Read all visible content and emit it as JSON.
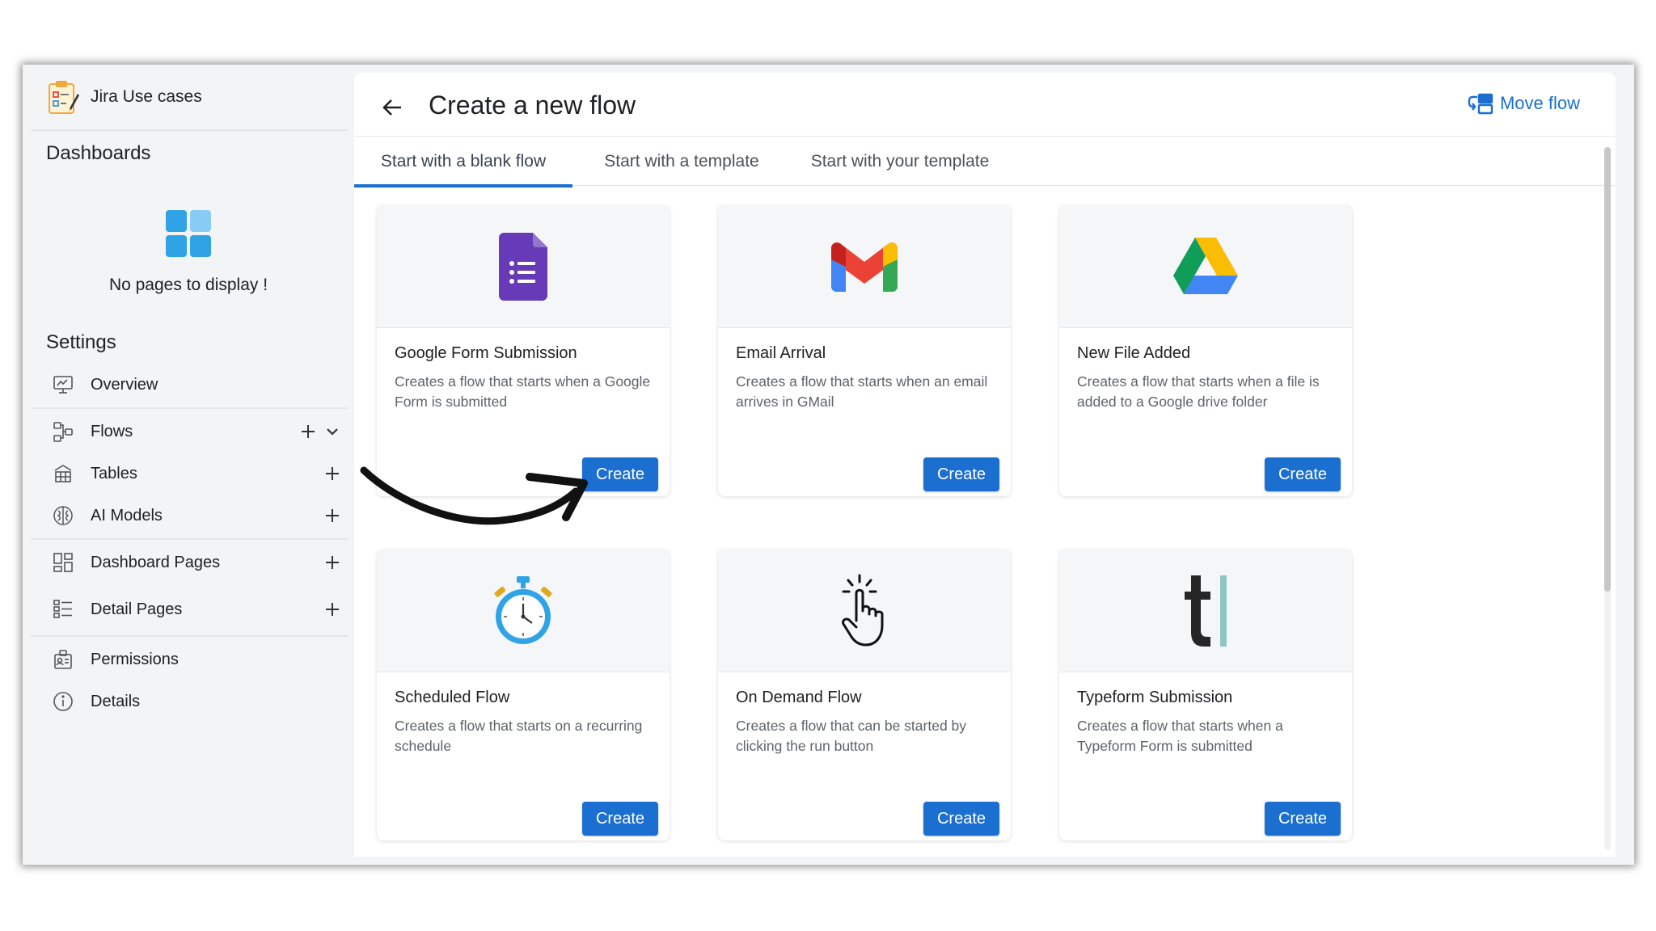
{
  "app": {
    "name": "Jira Use cases"
  },
  "sidebar": {
    "dashboards_title": "Dashboards",
    "empty_text": "No pages to display !",
    "settings_title": "Settings",
    "items": [
      {
        "label": "Overview",
        "icon": "monitor-icon"
      },
      {
        "label": "Flows",
        "icon": "flow-icon"
      },
      {
        "label": "Tables",
        "icon": "table-icon"
      },
      {
        "label": "AI Models",
        "icon": "ai-model-icon"
      },
      {
        "label": "Dashboard Pages",
        "icon": "dashboard-pages-icon"
      },
      {
        "label": "Detail Pages",
        "icon": "detail-pages-icon"
      },
      {
        "label": "Permissions",
        "icon": "permissions-icon"
      },
      {
        "label": "Details",
        "icon": "info-icon"
      }
    ]
  },
  "header": {
    "title": "Create a new flow",
    "move_flow": "Move flow"
  },
  "tabs": [
    {
      "label": "Start with a blank flow",
      "active": true
    },
    {
      "label": "Start with a template",
      "active": false
    },
    {
      "label": "Start with your template",
      "active": false
    }
  ],
  "cards": [
    {
      "title": "Google Form Submission",
      "desc": "Creates a flow that starts when a Google Form is submitted",
      "button": "Create",
      "icon": "google-forms-icon"
    },
    {
      "title": "Email Arrival",
      "desc": "Creates a flow that starts when an email arrives in GMail",
      "button": "Create",
      "icon": "gmail-icon"
    },
    {
      "title": "New File Added",
      "desc": "Creates a flow that starts when a file is added to a Google drive folder",
      "button": "Create",
      "icon": "google-drive-icon"
    },
    {
      "title": "Scheduled Flow",
      "desc": "Creates a flow that starts on a recurring schedule",
      "button": "Create",
      "icon": "stopwatch-icon"
    },
    {
      "title": "On Demand Flow",
      "desc": "Creates a flow that can be started by clicking the run button",
      "button": "Create",
      "icon": "tap-hand-icon"
    },
    {
      "title": "Typeform Submission",
      "desc": "Creates a flow that starts when a Typeform Form is submitted",
      "button": "Create",
      "icon": "typeform-icon"
    }
  ],
  "colors": {
    "accent": "#1a6fd1",
    "sidebar_bg": "#f3f4f6",
    "card_top_bg": "#f5f6f8",
    "forms_purple": "#673ab7",
    "stopwatch_blue": "#2fa3e6"
  }
}
